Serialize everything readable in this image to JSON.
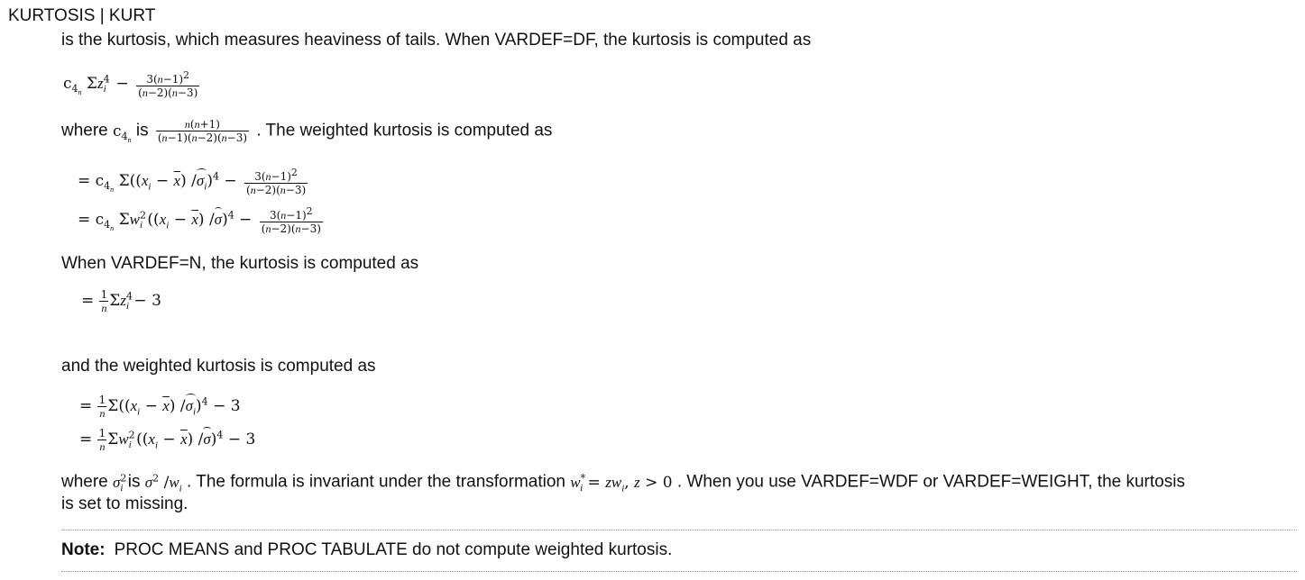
{
  "term": "KURTOSIS | KURT",
  "intro": "is the kurtosis, which measures heaviness of tails. When VARDEF=DF, the kurtosis is computed as",
  "where_prefix": "where",
  "where_is": "is",
  "weighted_intro": ". The weighted kurtosis is computed as",
  "vardef_n": "When VARDEF=N, the kurtosis is computed as",
  "weighted_n": "and the weighted kurtosis is computed as",
  "where2_prefix": "where",
  "where2_is": "is",
  "where2_text": ". The formula is invariant under the transformation",
  "where2_tail": ". When you use VARDEF=WDF or VARDEF=WEIGHT, the kurtosis",
  "where2_line2": "is set to missing.",
  "note_label": "Note:",
  "note_text": "PROC MEANS and PROC TABULATE do not compute weighted kurtosis."
}
